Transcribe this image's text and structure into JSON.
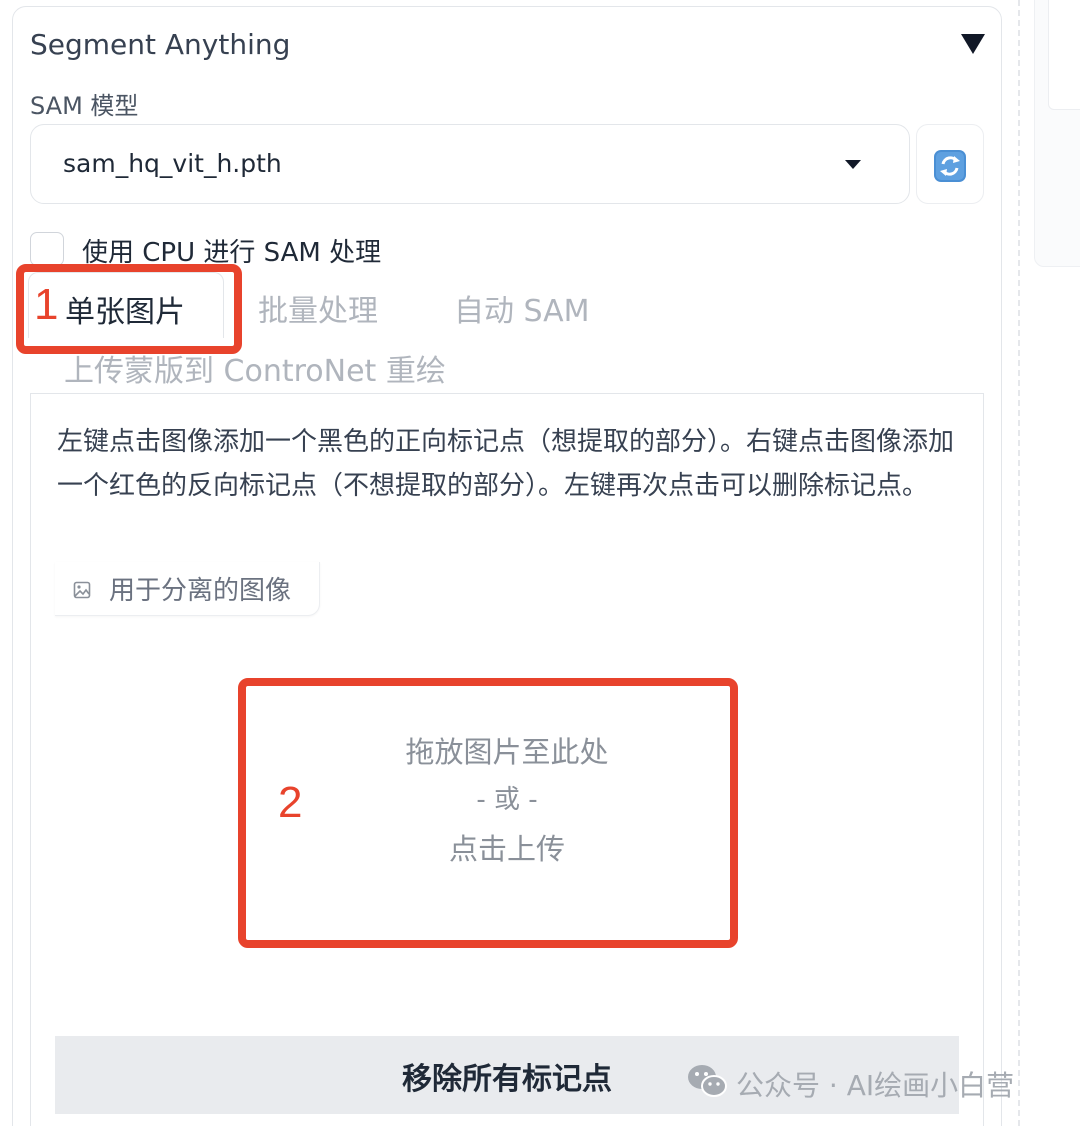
{
  "accordion": {
    "title": "Segment Anything",
    "collapse_icon": "triangle-down-icon"
  },
  "sam_model": {
    "label": "SAM 模型",
    "selected": "sam_hq_vit_h.pth",
    "dropdown_icon": "chevron-down-icon",
    "refresh_icon": "refresh-icon"
  },
  "cpu_option": {
    "label": "使用 CPU 进行 SAM 处理",
    "checked": false
  },
  "tabs": [
    {
      "label": "单张图片",
      "active": true
    },
    {
      "label": "批量处理",
      "active": false
    },
    {
      "label": "自动 SAM",
      "active": false
    },
    {
      "label": "上传蒙版到 ControNet 重绘",
      "active": false
    }
  ],
  "panel": {
    "instructions": "左键点击图像添加一个黑色的正向标记点（想提取的部分）。右键点击图像添加一个红色的反向标记点（不想提取的部分）。左键再次点击可以删除标记点。",
    "image_label": "用于分离的图像",
    "image_label_icon": "image-icon",
    "upload_line1": "拖放图片至此处",
    "upload_line2": "- 或 -",
    "upload_line3": "点击上传",
    "remove_button": "移除所有标记点"
  },
  "annotations": {
    "first": "1",
    "second": "2",
    "color": "#e8432c"
  },
  "watermark": {
    "icon": "wechat-icon",
    "text": "公众号 · AI绘画小白营"
  }
}
